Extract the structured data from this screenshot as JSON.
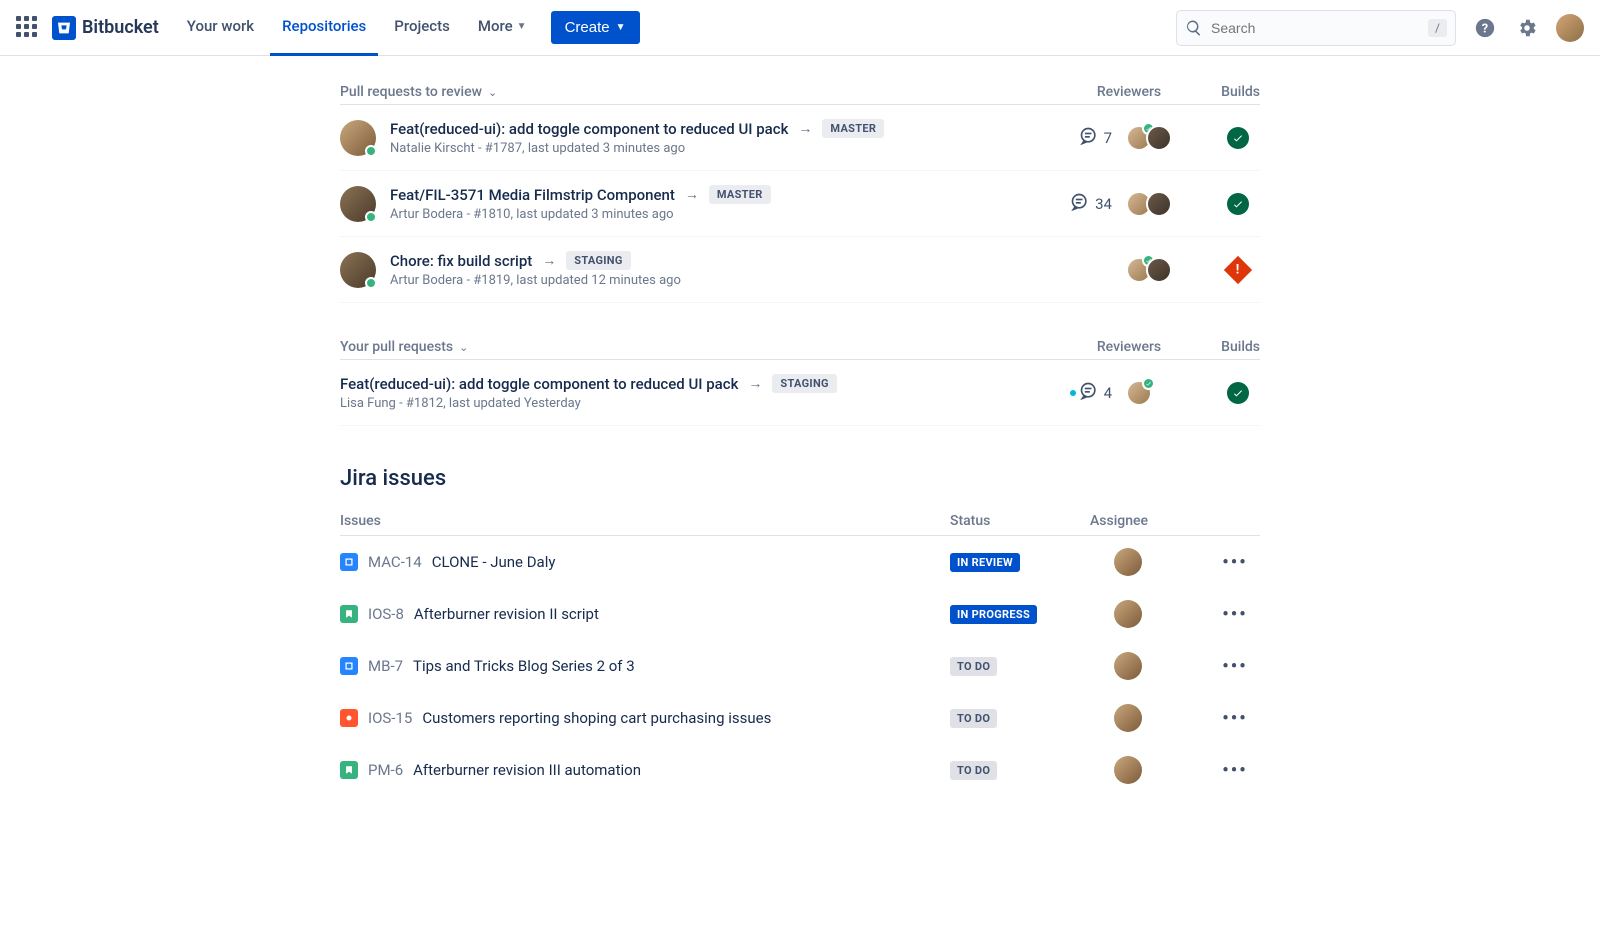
{
  "nav": {
    "brand": "Bitbucket",
    "items": [
      "Your work",
      "Repositories",
      "Projects",
      "More"
    ],
    "active_index": 1,
    "create": "Create",
    "search_placeholder": "Search",
    "kbd": "/"
  },
  "pr_review": {
    "heading": "Pull requests to review",
    "cols": {
      "reviewers": "Reviewers",
      "builds": "Builds"
    },
    "items": [
      {
        "title": "Feat(reduced-ui): add toggle component to reduced UI pack",
        "branch": "MASTER",
        "meta": "Natalie Kirscht - #1787, last updated  3 minutes ago",
        "comments": "7",
        "build": "ok",
        "reviewers": 2,
        "approved": true,
        "avatar": "a"
      },
      {
        "title": "Feat/FIL-3571 Media Filmstrip Component",
        "branch": "MASTER",
        "meta": "Artur Bodera - #1810, last updated 3 minutes ago",
        "comments": "34",
        "build": "ok",
        "reviewers": 2,
        "approved": false,
        "avatar": "b"
      },
      {
        "title": "Chore: fix build script",
        "branch": "STAGING",
        "meta": "Artur Bodera - #1819, last updated  12 minutes ago",
        "comments": "",
        "build": "fail",
        "reviewers": 2,
        "approved": true,
        "avatar": "b"
      }
    ]
  },
  "your_pr": {
    "heading": "Your pull requests",
    "cols": {
      "reviewers": "Reviewers",
      "builds": "Builds"
    },
    "items": [
      {
        "title": "Feat(reduced-ui): add toggle component to reduced UI pack",
        "branch": "STAGING",
        "meta": "Lisa Fung - #1812, last updated Yesterday",
        "comments": "4",
        "new_comments": true,
        "build": "ok",
        "reviewers": 1,
        "approved": true
      }
    ]
  },
  "jira": {
    "heading": "Jira issues",
    "cols": {
      "issues": "Issues",
      "status": "Status",
      "assignee": "Assignee"
    },
    "items": [
      {
        "icon": "task",
        "key": "MAC-14",
        "title": "CLONE - June Daly",
        "status": "IN REVIEW",
        "status_class": "review"
      },
      {
        "icon": "story",
        "key": "IOS-8",
        "title": "Afterburner revision II script",
        "status": "IN PROGRESS",
        "status_class": "progress"
      },
      {
        "icon": "task",
        "key": "MB-7",
        "title": "Tips and Tricks Blog Series 2 of 3",
        "status": "TO DO",
        "status_class": "todo"
      },
      {
        "icon": "bug",
        "key": "IOS-15",
        "title": "Customers reporting shoping cart purchasing issues",
        "status": "TO DO",
        "status_class": "todo"
      },
      {
        "icon": "story",
        "key": "PM-6",
        "title": "Afterburner revision III automation",
        "status": "TO DO",
        "status_class": "todo"
      }
    ]
  }
}
